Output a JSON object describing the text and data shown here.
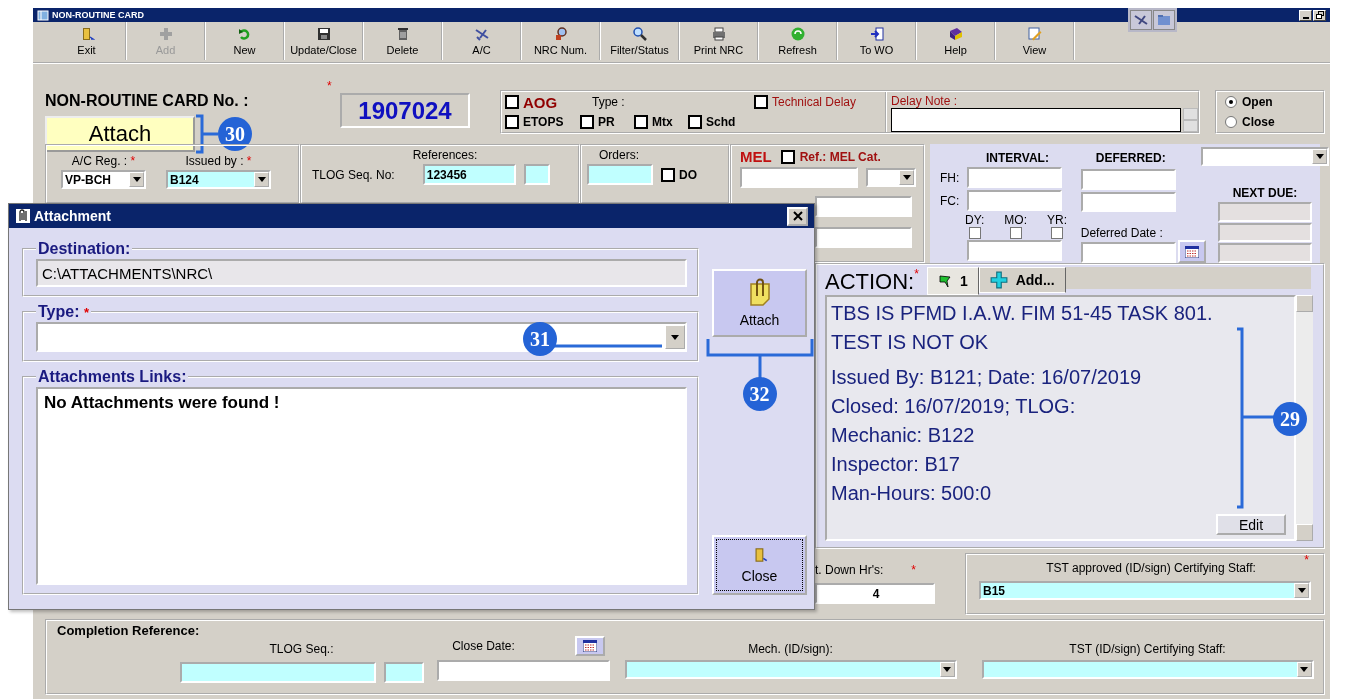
{
  "window": {
    "title": "NON-ROUTINE CARD"
  },
  "toolbar": [
    {
      "label": "Exit",
      "disabled": false
    },
    {
      "label": "Add",
      "disabled": true
    },
    {
      "label": "New",
      "disabled": false
    },
    {
      "label": "Update/Close",
      "disabled": false
    },
    {
      "label": "Delete",
      "disabled": false
    },
    {
      "label": "A/C",
      "disabled": false
    },
    {
      "label": "NRC Num.",
      "disabled": false
    },
    {
      "label": "Filter/Status",
      "disabled": false
    },
    {
      "label": "Print NRC",
      "disabled": false
    },
    {
      "label": "Refresh",
      "disabled": false
    },
    {
      "label": "To WO",
      "disabled": false
    },
    {
      "label": "Help",
      "disabled": false
    },
    {
      "label": "View",
      "disabled": false
    }
  ],
  "card": {
    "label": "NON-ROUTINE CARD No. :",
    "required_mark": "*",
    "number": "1907024",
    "attach_button": "Attach"
  },
  "flags": {
    "aog": {
      "label": "AOG",
      "checked": false
    },
    "etops": {
      "label": "ETOPS",
      "checked": false
    },
    "type_label": "Type :",
    "types": [
      {
        "label": "PR",
        "checked": false
      },
      {
        "label": "Mtx",
        "checked": false
      },
      {
        "label": "Schd",
        "checked": false
      }
    ],
    "technical_delay": {
      "label": "Technical Delay",
      "checked": false
    },
    "delay_note_label": "Delay Note :"
  },
  "status": [
    {
      "label": "Open",
      "selected": true
    },
    {
      "label": "Close",
      "selected": false
    }
  ],
  "aircraft": {
    "reg_label": "A/C Reg. :",
    "reg_mark": "*",
    "reg_value": "VP-BCH",
    "issued_label": "Issued by :",
    "issued_mark": "*",
    "issued_value": "B124"
  },
  "references": {
    "title": "References:",
    "tlog_label": "TLOG Seq. No:",
    "tlog_value": "123456"
  },
  "orders": {
    "title": "Orders:",
    "do_label": "DO",
    "do_checked": false
  },
  "mel": {
    "title": "MEL",
    "ref_label": "Ref.: MEL Cat.",
    "ref_checked": false
  },
  "interval": {
    "interval_title": "INTERVAL:",
    "deferred_title": "DEFERRED:",
    "fh_label": "FH:",
    "fc_label": "FC:",
    "period": [
      {
        "label": "DY:",
        "checked": false
      },
      {
        "label": "MO:",
        "checked": false
      },
      {
        "label": "YR:",
        "checked": false
      }
    ],
    "deferred_date_label": "Deferred Date :",
    "next_due_title": "NEXT DUE:"
  },
  "action": {
    "title": "ACTION:",
    "required_mark": "*",
    "tabs": [
      {
        "label": "1",
        "selected": true,
        "kind": "entry"
      },
      {
        "label": "Add...",
        "selected": false,
        "kind": "add"
      }
    ],
    "paragraphs": [
      [
        "TBS IS PFMD I.A.W. FIM 51-45 TASK 801.",
        "TEST IS NOT OK"
      ],
      [
        "Issued By: B121; Date: 16/07/2019",
        "Closed: 16/07/2019;  TLOG:",
        "Mechanic: B122",
        "Inspector: B17",
        "Man-Hours: 500:0"
      ]
    ],
    "edit_button": "Edit"
  },
  "work": {
    "down_hrs_label": "t. Down Hr's:",
    "down_hrs_mark": "*",
    "down_hrs_value": "4",
    "tst_label": "TST approved (ID/sign) Certifying Staff:",
    "tst_mark": "*",
    "tst_value": "B15"
  },
  "completion": {
    "title": "Completion Reference:",
    "tlog_label": "TLOG Seq.:",
    "close_date_label": "Close Date:",
    "mech_label": "Mech. (ID/sign):",
    "tst_label": "TST (ID/sign) Certifying Staff:"
  },
  "dialog": {
    "title": "Attachment",
    "destination_label": "Destination:",
    "destination_value": "C:\\ATTACHMENTS\\NRC\\",
    "type_label": "Type:",
    "type_mark": "*",
    "links_label": "Attachments Links:",
    "links_message": "No Attachments were found !",
    "attach_button": "Attach",
    "close_button": "Close"
  },
  "callouts": {
    "attach": "30",
    "type": "31",
    "dialog_attach": "32",
    "action": "29"
  }
}
